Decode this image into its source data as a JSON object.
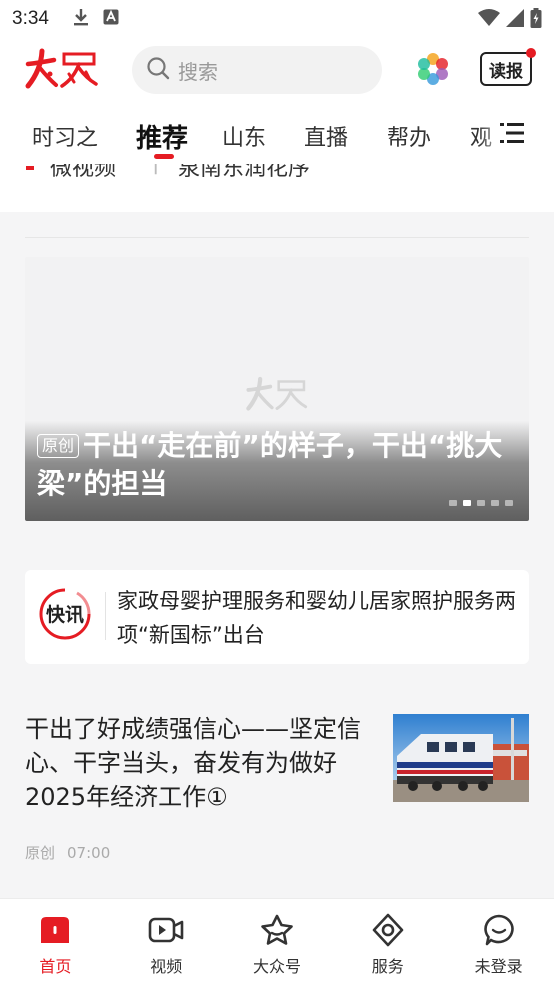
{
  "status_bar": {
    "time": "3:34"
  },
  "header": {
    "logo_text": "大众",
    "search_placeholder": "搜索",
    "dubao_label": "读报"
  },
  "tabs": [
    {
      "label": "时习之",
      "active": false
    },
    {
      "label": "推荐",
      "active": true
    },
    {
      "label": "山东",
      "active": false
    },
    {
      "label": "直播",
      "active": false
    },
    {
      "label": "帮办",
      "active": false
    },
    {
      "label": "观",
      "active": false
    }
  ],
  "cut_row": {
    "left_text": "微视频",
    "right_text": "泉南东润花序"
  },
  "banner": {
    "tag": "原创",
    "title": "干出“走在前”的样子，干出“挑大梁”的担当",
    "dot_count": 5,
    "active_dot": 1
  },
  "kuaixun": {
    "badge": "快讯",
    "text": "家政母婴护理服务和婴幼儿居家照护服务两项“新国标”出台"
  },
  "article": {
    "title": "干出了好成绩强信心——坚定信心、干字当头，奋发有为做好2025年经济工作①",
    "source": "原创",
    "time": "07:00"
  },
  "bottom_nav": [
    {
      "label": "首页",
      "icon": "home-icon",
      "active": true
    },
    {
      "label": "视频",
      "icon": "video-icon",
      "active": false
    },
    {
      "label": "大众号",
      "icon": "star-icon",
      "active": false
    },
    {
      "label": "服务",
      "icon": "service-icon",
      "active": false
    },
    {
      "label": "未登录",
      "icon": "user-icon",
      "active": false
    }
  ],
  "colors": {
    "brand_red": "#e51c23",
    "feed_bg": "#f5f5f6"
  }
}
